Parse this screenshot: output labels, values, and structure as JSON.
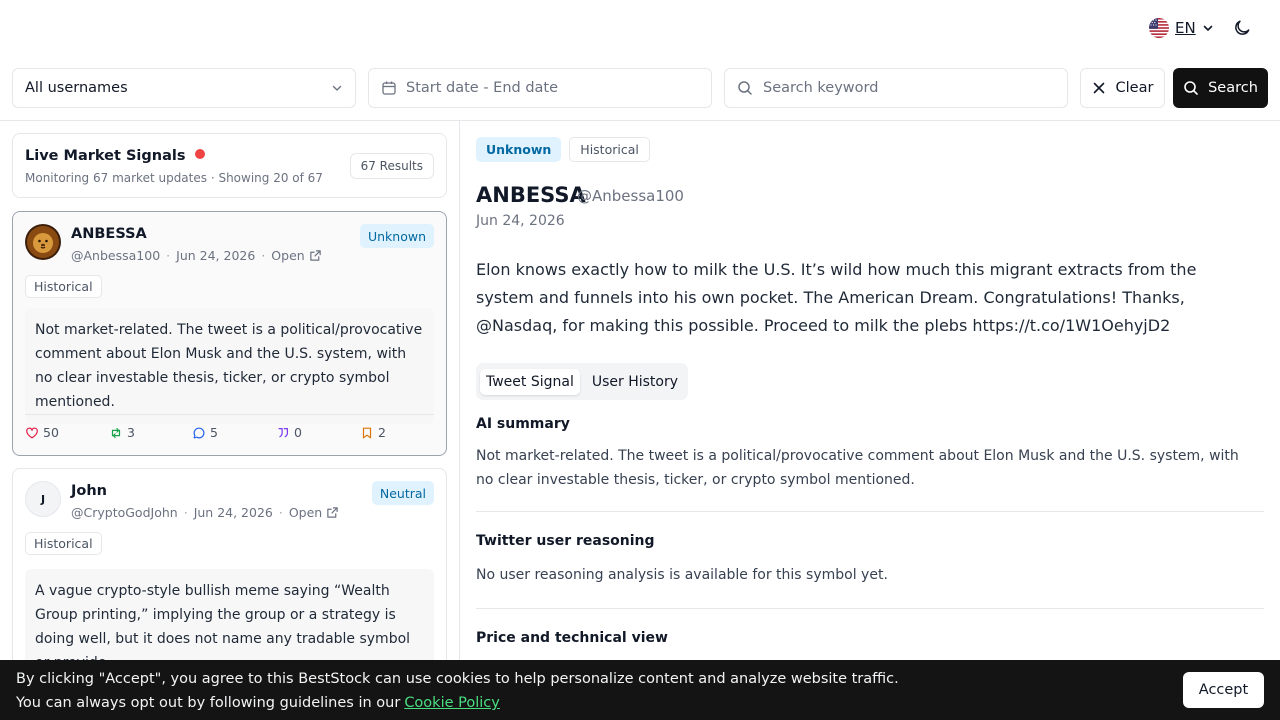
{
  "header": {
    "language_code": "EN",
    "flag_icon": "us-flag-icon",
    "theme_icon": "moon-icon"
  },
  "filters": {
    "username_select": "All usernames",
    "date_range_placeholder": "Start date - End date",
    "search_placeholder": "Search keyword",
    "clear_label": "Clear",
    "search_label": "Search"
  },
  "signals": {
    "title": "Live Market Signals",
    "subtitle": "Monitoring 67 market updates · Showing 20 of 67",
    "results_badge": "67 Results"
  },
  "tweets": [
    {
      "name": "ANBESSA",
      "handle": "@Anbessa100",
      "date": "Jun 24, 2026",
      "open_label": "Open",
      "sentiment": "Unknown",
      "tag": "Historical",
      "summary": "Not market-related. The tweet is a political/provocative comment about Elon Musk and the U.S. system, with no clear investable thesis, ticker, or crypto symbol mentioned.",
      "likes": "50",
      "retweets": "3",
      "replies": "5",
      "quotes": "0",
      "bookmarks": "2"
    },
    {
      "name": "John",
      "avatar_letter": "J",
      "handle": "@CryptoGodJohn",
      "date": "Jun 24, 2026",
      "open_label": "Open",
      "sentiment": "Neutral",
      "tag": "Historical",
      "summary": "A vague crypto-style bullish meme saying “Wealth Group printing,” implying the group or a strategy is doing well, but it does not name any tradable symbol or provide…"
    }
  ],
  "detail": {
    "sentiment": "Unknown",
    "tag": "Historical",
    "name": "ANBESSA",
    "handle": "@Anbessa100",
    "date": "Jun 24, 2026",
    "text": "Elon knows exactly how to milk the U.S. It’s wild how much this migrant extracts from the system and funnels into his own pocket. The American Dream. Congratulations! Thanks, @Nasdaq, for making this possible. Proceed to milk the plebs https://t.co/1W1OehyjD2",
    "tabs": [
      "Tweet Signal",
      "User History"
    ],
    "ai_summary_title": "AI summary",
    "ai_summary_text": "Not market-related. The tweet is a political/provocative comment about Elon Musk and the U.S. system, with no clear investable thesis, ticker, or crypto symbol mentioned.",
    "reasoning_title": "Twitter user reasoning",
    "reasoning_text": "No user reasoning analysis is available for this symbol yet.",
    "price_title": "Price and technical view"
  },
  "cookie": {
    "line1": "By clicking \"Accept\", you agree to this BestStock can use cookies to help personalize content and analyze website traffic.",
    "line2": "You can always opt out by following guidelines in our",
    "link": "Cookie Policy",
    "accept_label": "Accept"
  },
  "colors": {
    "accent_dark": "#111111",
    "unknown_badge_bg": "#e0f2fe",
    "unknown_badge_text": "#0369a1",
    "live_dot": "#ef4444",
    "cookie_link": "#4ade80",
    "like_icon": "#e11d48",
    "retweet_icon": "#16a34a",
    "reply_icon": "#2563eb",
    "quote_icon": "#7c3aed",
    "bookmark_icon": "#d97706"
  }
}
